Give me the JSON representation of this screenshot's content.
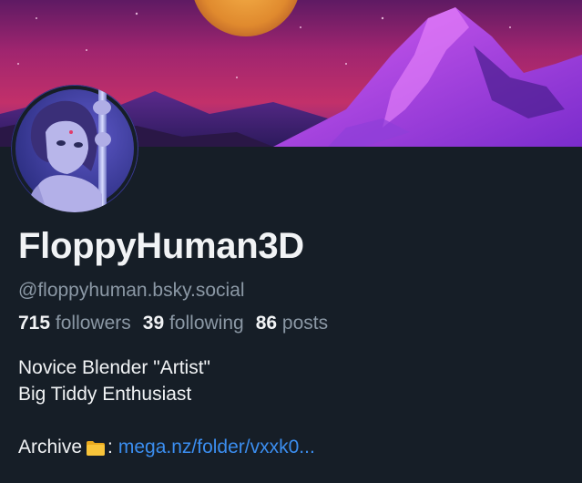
{
  "profile": {
    "display_name": "FloppyHuman3D",
    "handle": "@floppyhuman.bsky.social",
    "stats": {
      "followers_count": "715",
      "followers_label": "followers",
      "following_count": "39",
      "following_label": "following",
      "posts_count": "86",
      "posts_label": "posts"
    },
    "bio": {
      "line1": "Novice Blender \"Artist\"",
      "line2": "Big Tiddy Enthusiast",
      "archive_prefix": "Archive",
      "archive_colon": ":",
      "archive_icon": "folder-icon",
      "archive_link": "mega.nz/folder/vxxk0..."
    }
  },
  "colors": {
    "background": "#161e27",
    "primary_text": "#f1f3f5",
    "secondary_text": "#8b98a5",
    "link": "#3b8ef0",
    "banner_sky_top": "#8a1f6e",
    "banner_mountain": "#a53bd6"
  }
}
